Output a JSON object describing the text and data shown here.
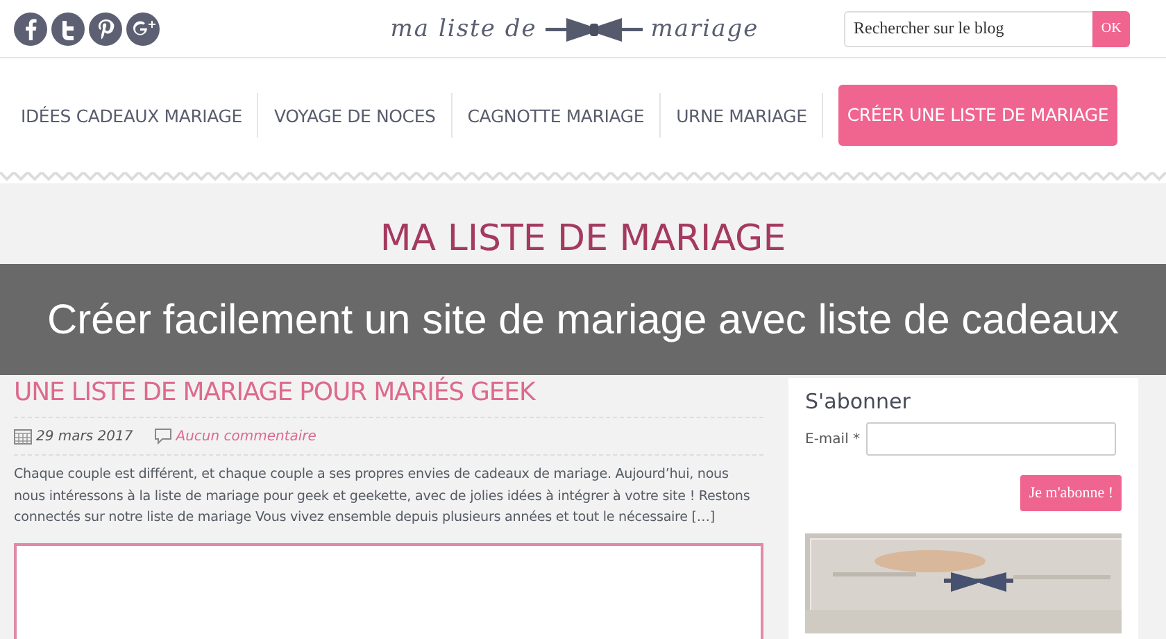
{
  "header": {
    "social": [
      {
        "kind": "facebook"
      },
      {
        "kind": "twitter"
      },
      {
        "kind": "pinterest"
      },
      {
        "kind": "googleplus"
      }
    ],
    "logo": {
      "left": "ma liste de",
      "right": "mariage"
    },
    "search": {
      "placeholder": "Rechercher sur le blog",
      "button": "OK"
    }
  },
  "nav": [
    {
      "label": "IDÉES CADEAUX MARIAGE",
      "selected": false
    },
    {
      "label": "VOYAGE DE NOCES",
      "selected": false
    },
    {
      "label": "CAGNOTTE MARIAGE",
      "selected": false
    },
    {
      "label": "URNE MARIAGE",
      "selected": false
    },
    {
      "label": "CRÉER UNE LISTE DE MARIAGE",
      "selected": true
    }
  ],
  "page_title": "MA LISTE DE MARIAGE",
  "caption": "Créer facilement un site de mariage avec liste de cadeaux",
  "post": {
    "title": "UNE LISTE DE MARIAGE POUR MARIÉS GEEK",
    "date": "29 mars 2017",
    "comments": "Aucun commentaire",
    "excerpt": "Chaque couple est différent, et chaque couple a ses propres envies de cadeaux de mariage. Aujourd’hui, nous nous intéressons à la liste de mariage pour geek et geekette, avec de jolies idées à intégrer à votre site !   Restons connectés sur notre liste de mariage Vous vivez ensemble depuis plusieurs années et tout le nécessaire […]"
  },
  "sidebar": {
    "title": "S'abonner",
    "email_label": "E-mail *",
    "button": "Je m'abonne !"
  }
}
